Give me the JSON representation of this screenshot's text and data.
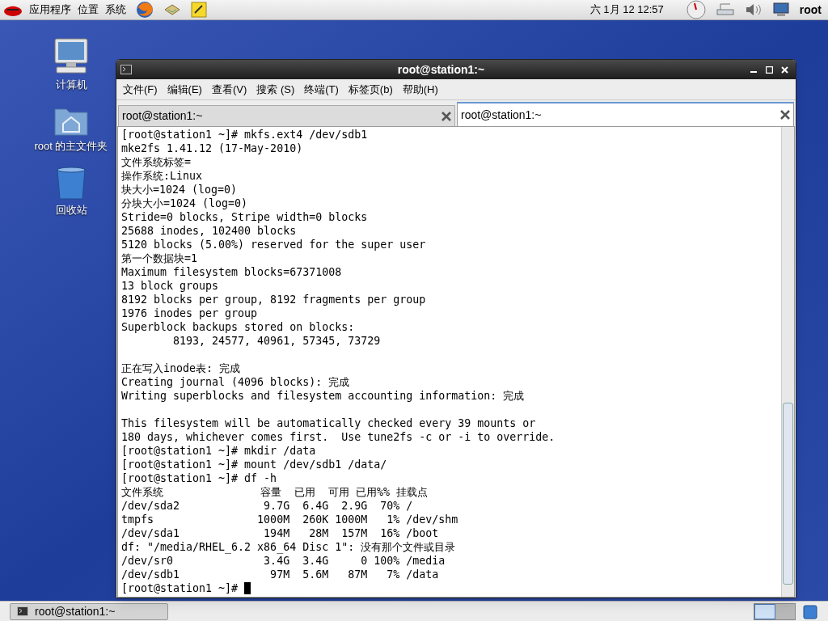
{
  "top_panel": {
    "menus": [
      "应用程序",
      "位置",
      "系统"
    ],
    "clock": "六 1月 12 12:57",
    "user": "root"
  },
  "desktop_icons": [
    {
      "kind": "computer",
      "label": "计算机"
    },
    {
      "kind": "home",
      "label": "root 的主文件夹"
    },
    {
      "kind": "trash",
      "label": "回收站"
    }
  ],
  "window": {
    "title": "root@station1:~",
    "menu": [
      "文件(F)",
      "编辑(E)",
      "查看(V)",
      "搜索 (S)",
      "终端(T)",
      "标签页(b)",
      "帮助(H)"
    ],
    "tabs": [
      {
        "label": "root@station1:~",
        "selected": false
      },
      {
        "label": "root@station1:~",
        "selected": true
      }
    ],
    "terminal_blocks": [
      [
        "[root@station1 ~]# mkfs.ext4 /dev/sdb1",
        "mke2fs 1.41.12 (17-May-2010)",
        "文件系统标签=",
        "操作系统:Linux",
        "块大小=1024 (log=0)",
        "分块大小=1024 (log=0)",
        "Stride=0 blocks, Stripe width=0 blocks",
        "25688 inodes, 102400 blocks",
        "5120 blocks (5.00%) reserved for the super user",
        "第一个数据块=1",
        "Maximum filesystem blocks=67371008",
        "13 block groups",
        "8192 blocks per group, 8192 fragments per group",
        "1976 inodes per group",
        "Superblock backups stored on blocks:",
        "        8193, 24577, 40961, 57345, 73729"
      ],
      [
        "正在写入inode表: 完成",
        "Creating journal (4096 blocks): 完成",
        "Writing superblocks and filesystem accounting information: 完成"
      ],
      [
        "This filesystem will be automatically checked every 39 mounts or",
        "180 days, whichever comes first.  Use tune2fs -c or -i to override.",
        "[root@station1 ~]# mkdir /data",
        "[root@station1 ~]# mount /dev/sdb1 /data/",
        "[root@station1 ~]# df -h",
        "文件系统               容量  已用  可用 已用%% 挂载点",
        "/dev/sda2             9.7G  6.4G  2.9G  70% /",
        "tmpfs                1000M  260K 1000M   1% /dev/shm",
        "/dev/sda1             194M   28M  157M  16% /boot",
        "df: \"/media/RHEL_6.2 x86_64 Disc 1\": 没有那个文件或目录",
        "/dev/sr0              3.4G  3.4G     0 100% /media",
        "/dev/sdb1              97M  5.6M   87M   7% /data"
      ]
    ],
    "prompt": "[root@station1 ~]# "
  },
  "taskbar": {
    "tasks": [
      "root@station1:~"
    ]
  }
}
